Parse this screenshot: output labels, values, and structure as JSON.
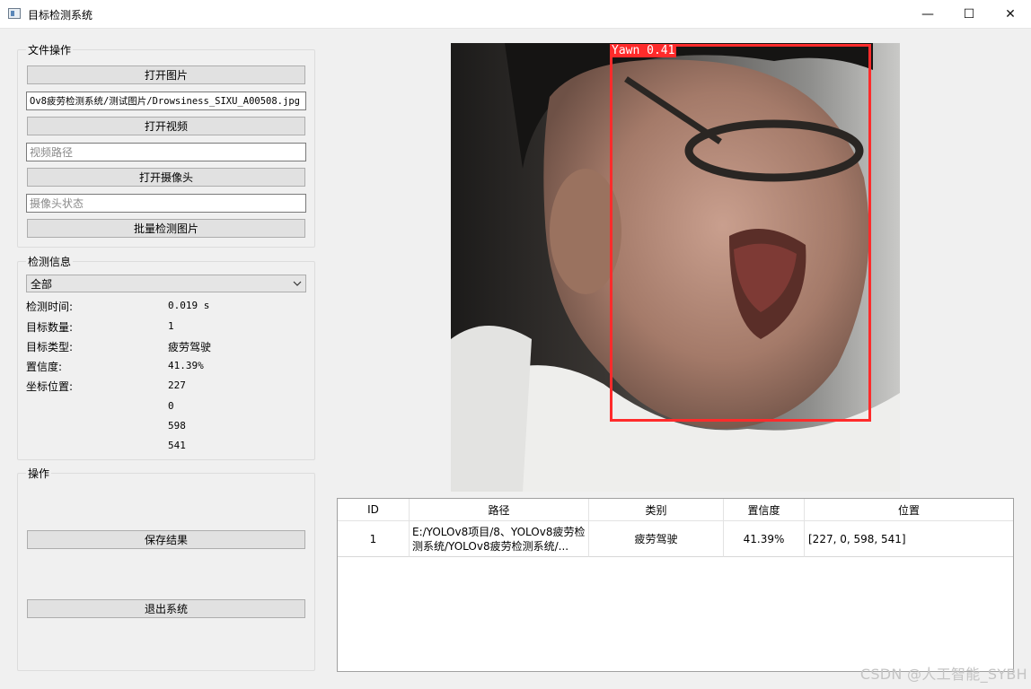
{
  "window": {
    "title": "目标检测系统",
    "minimize": "—",
    "maximize": "☐",
    "close": "✕"
  },
  "file_ops": {
    "group_title": "文件操作",
    "open_image": "打开图片",
    "image_path": "Ov8疲劳检测系统/测试图片/Drowsiness_SIXU_A00508.jpg",
    "open_video": "打开视频",
    "video_path_placeholder": "视频路径",
    "open_camera": "打开摄像头",
    "camera_status_placeholder": "摄像头状态",
    "batch_detect": "批量检测图片"
  },
  "detect_info": {
    "group_title": "检测信息",
    "filter_selected": "全部",
    "time_label": "检测时间:",
    "time_value": "0.019 s",
    "count_label": "目标数量:",
    "count_value": "1",
    "type_label": "目标类型:",
    "type_value": "疲劳驾驶",
    "conf_label": "置信度:",
    "conf_value": "41.39%",
    "pos_label": "坐标位置:",
    "pos_values": [
      "227",
      "0",
      "598",
      "541"
    ]
  },
  "ops": {
    "group_title": "操作",
    "save": "保存结果",
    "exit": "退出系统"
  },
  "image": {
    "detection_label": "Yawn  0.41",
    "box_color": "#ff2b2b"
  },
  "table": {
    "headers": [
      "ID",
      "路径",
      "类别",
      "置信度",
      "位置"
    ],
    "rows": [
      {
        "id": "1",
        "path_line1": "E:/YOLOv8项目/8、YOLOv8疲劳检",
        "path_line2": "测系统/YOLOv8疲劳检测系统/...",
        "category": "疲劳驾驶",
        "confidence": "41.39%",
        "position": "[227, 0, 598, 541]"
      }
    ]
  },
  "watermark": "CSDN @人工智能_SYBH"
}
